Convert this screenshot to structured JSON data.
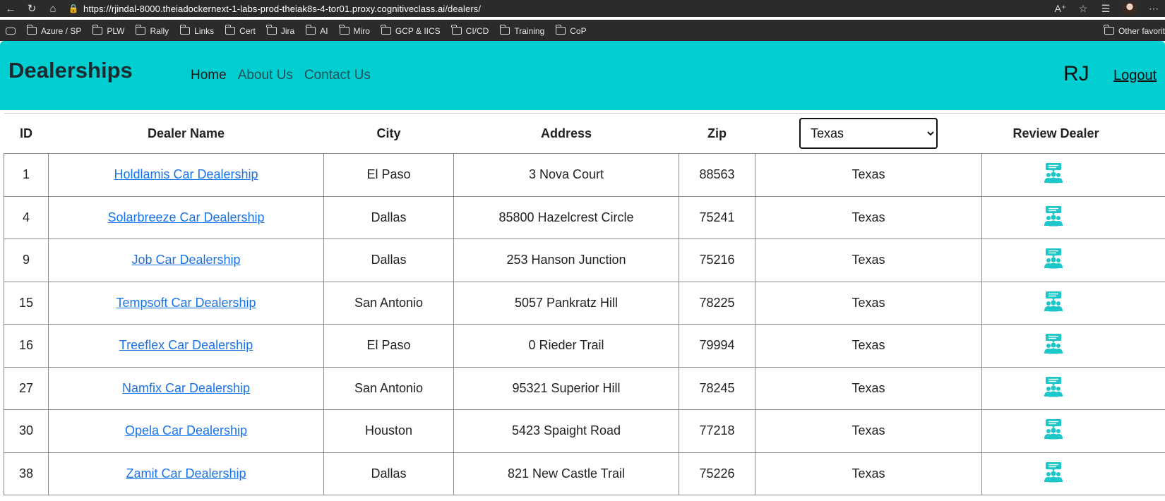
{
  "browser": {
    "url_host": "https://rjindal-8000.theiadockernext-1-labs-prod-theiak8s-4-tor01.proxy.cognitiveclass.ai",
    "url_path": "/dealers/",
    "bookmarks": [
      "Azure / SP",
      "PLW",
      "Rally",
      "Links",
      "Cert",
      "Jira",
      "AI",
      "Miro",
      "GCP & IICS",
      "CI/CD",
      "Training",
      "CoP"
    ],
    "other_favorites": "Other favorit"
  },
  "header": {
    "brand": "Dealerships",
    "nav": [
      "Home",
      "About Us",
      "Contact Us"
    ],
    "user": "RJ",
    "logout": "Logout"
  },
  "table": {
    "columns": [
      "ID",
      "Dealer Name",
      "City",
      "Address",
      "Zip",
      "Review Dealer"
    ],
    "state_filter": "Texas",
    "rows": [
      {
        "id": "1",
        "name": "Holdlamis Car Dealership",
        "city": "El Paso",
        "address": "3 Nova Court",
        "zip": "88563",
        "state": "Texas"
      },
      {
        "id": "4",
        "name": "Solarbreeze Car Dealership",
        "city": "Dallas",
        "address": "85800 Hazelcrest Circle",
        "zip": "75241",
        "state": "Texas"
      },
      {
        "id": "9",
        "name": "Job Car Dealership",
        "city": "Dallas",
        "address": "253 Hanson Junction",
        "zip": "75216",
        "state": "Texas"
      },
      {
        "id": "15",
        "name": "Tempsoft Car Dealership",
        "city": "San Antonio",
        "address": "5057 Pankratz Hill",
        "zip": "78225",
        "state": "Texas"
      },
      {
        "id": "16",
        "name": "Treeflex Car Dealership",
        "city": "El Paso",
        "address": "0 Rieder Trail",
        "zip": "79994",
        "state": "Texas"
      },
      {
        "id": "27",
        "name": "Namfix Car Dealership",
        "city": "San Antonio",
        "address": "95321 Superior Hill",
        "zip": "78245",
        "state": "Texas"
      },
      {
        "id": "30",
        "name": "Opela Car Dealership",
        "city": "Houston",
        "address": "5423 Spaight Road",
        "zip": "77218",
        "state": "Texas"
      },
      {
        "id": "38",
        "name": "Zamit Car Dealership",
        "city": "Dallas",
        "address": "821 New Castle Trail",
        "zip": "75226",
        "state": "Texas"
      }
    ]
  },
  "colors": {
    "header_bg": "#00ced1",
    "link": "#1a73e8",
    "review_icon": "#1cc6c9"
  },
  "icons": {
    "review": "review-people-icon"
  }
}
